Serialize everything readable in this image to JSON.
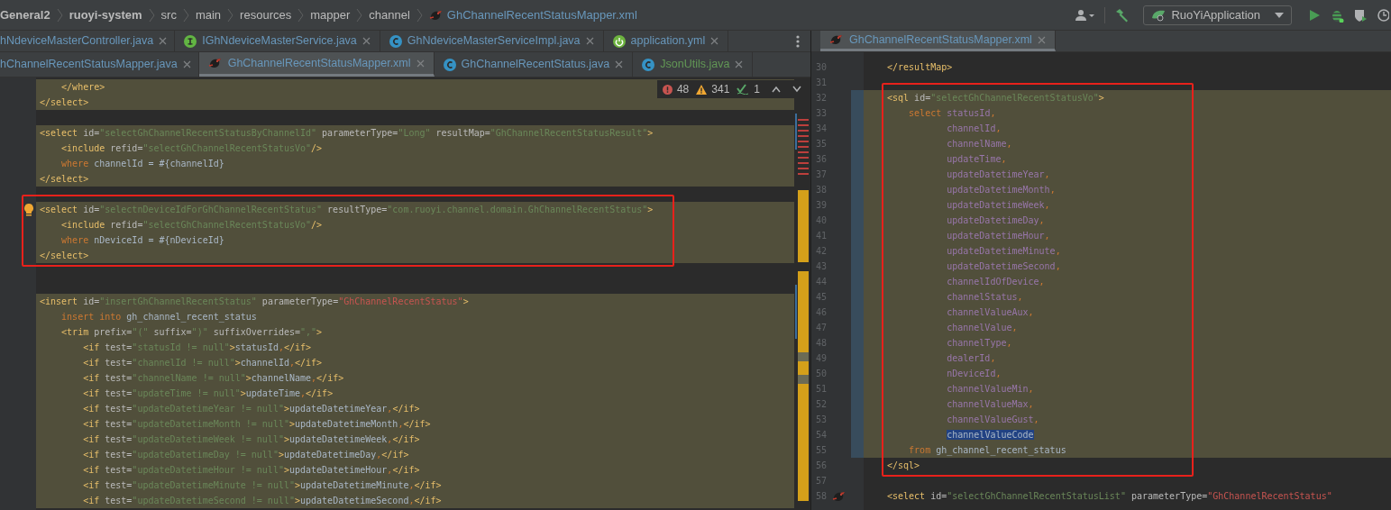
{
  "breadcrumbs": [
    {
      "label": "General2",
      "bold": true,
      "kind": "folder"
    },
    {
      "label": "ruoyi-system",
      "bold": true,
      "kind": "folder"
    },
    {
      "label": "src",
      "bold": false,
      "kind": "folder"
    },
    {
      "label": "main",
      "bold": false,
      "kind": "folder"
    },
    {
      "label": "resources",
      "bold": false,
      "kind": "folder"
    },
    {
      "label": "mapper",
      "bold": false,
      "kind": "folder"
    },
    {
      "label": "channel",
      "bold": false,
      "kind": "folder"
    },
    {
      "label": "GhChannelRecentStatusMapper.xml",
      "bold": false,
      "kind": "xml"
    }
  ],
  "run_config": {
    "label": "RuoYiApplication"
  },
  "left_editor": {
    "tab_rows": [
      [
        {
          "label": "hNdeviceMasterController.java",
          "kind": "none",
          "color": "#6897bb",
          "selected": false
        },
        {
          "label": "IGhNdeviceMasterService.java",
          "kind": "interface",
          "color": "#6897bb",
          "selected": false
        },
        {
          "label": "GhNdeviceMasterServiceImpl.java",
          "kind": "class",
          "color": "#6897bb",
          "selected": false
        },
        {
          "label": "application.yml",
          "kind": "spring",
          "color": "#6897bb",
          "selected": false
        }
      ],
      [
        {
          "label": "hChannelRecentStatusMapper.java",
          "kind": "none",
          "color": "#6897bb",
          "selected": false
        },
        {
          "label": "GhChannelRecentStatusMapper.xml",
          "kind": "xml",
          "color": "#6897bb",
          "selected": true
        },
        {
          "label": "GhChannelRecentStatus.java",
          "kind": "class",
          "color": "#6897bb",
          "selected": false
        },
        {
          "label": "JsonUtils.java",
          "kind": "class",
          "color": "#629755",
          "selected": false
        }
      ]
    ],
    "inspections": {
      "errors": "48",
      "warnings": "341",
      "typos": "1"
    },
    "lines": [
      {
        "highlighted": true,
        "tokens": [
          {
            "kind": "tag",
            "text": "    </where>"
          }
        ]
      },
      {
        "highlighted": true,
        "tokens": [
          {
            "kind": "tag",
            "text": "</select>"
          }
        ]
      },
      {
        "kind": "blank"
      },
      {
        "highlighted": true,
        "tokens": [
          {
            "kind": "tag",
            "text": "<select "
          },
          {
            "kind": "attr",
            "text": "id="
          },
          {
            "kind": "string",
            "text": "\"selectGhChannelRecentStatusByChannelId\""
          },
          {
            "kind": "attr",
            "text": " parameterType="
          },
          {
            "kind": "string",
            "text": "\"Long\""
          },
          {
            "kind": "attr",
            "text": " resultMap="
          },
          {
            "kind": "string",
            "text": "\"GhChannelRecentStatusResult\""
          },
          {
            "kind": "tag",
            "text": ">"
          }
        ]
      },
      {
        "highlighted": true,
        "tokens": [
          {
            "kind": "tag",
            "text": "    <include "
          },
          {
            "kind": "attr",
            "text": "refid="
          },
          {
            "kind": "string",
            "text": "\"selectGhChannelRecentStatusVo\""
          },
          {
            "kind": "tag",
            "text": "/>"
          }
        ]
      },
      {
        "highlighted": true,
        "tokens": [
          {
            "kind": "keyword",
            "text": "    where "
          },
          {
            "kind": "plain",
            "text": "channelId = #{channelId}"
          }
        ]
      },
      {
        "highlighted": true,
        "tokens": [
          {
            "kind": "tag",
            "text": "</select>"
          }
        ]
      },
      {
        "kind": "blank"
      },
      {
        "kind": "frame",
        "lines": [
          {
            "highlighted": true,
            "kind": "intention",
            "tokens": [
              {
                "kind": "tag",
                "text": "<select "
              },
              {
                "kind": "attr",
                "text": "id="
              },
              {
                "kind": "string",
                "text": "\"selectnDeviceIdForGhChannelRecentStatus\""
              },
              {
                "kind": "attr",
                "text": " resultType="
              },
              {
                "kind": "string",
                "text": "\"com.ruoyi.channel.domain.GhChannelRecentStatus\""
              },
              {
                "kind": "tag",
                "text": ">"
              }
            ]
          },
          {
            "highlighted": true,
            "tokens": [
              {
                "kind": "tag",
                "text": "    <include "
              },
              {
                "kind": "attr",
                "text": "refid="
              },
              {
                "kind": "string",
                "text": "\"selectGhChannelRecentStatusVo\""
              },
              {
                "kind": "tag",
                "text": "/>"
              }
            ]
          },
          {
            "highlighted": true,
            "tokens": [
              {
                "kind": "keyword",
                "text": "    where "
              },
              {
                "kind": "plain",
                "text": "nDeviceId = #{nDeviceId}"
              }
            ]
          },
          {
            "highlighted": true,
            "tokens": [
              {
                "kind": "tag",
                "text": "</select>"
              }
            ]
          }
        ]
      },
      {
        "kind": "blank"
      },
      {
        "kind": "blank"
      },
      {
        "highlighted": true,
        "tokens": [
          {
            "kind": "tag",
            "text": "<insert "
          },
          {
            "kind": "attr",
            "text": "id="
          },
          {
            "kind": "string",
            "text": "\"insertGhChannelRecentStatus\""
          },
          {
            "kind": "attr",
            "text": " parameterType="
          },
          {
            "kind": "error",
            "text": "\"GhChannelRecentStatus\""
          },
          {
            "kind": "tag",
            "text": ">"
          }
        ]
      },
      {
        "highlighted": true,
        "tokens": [
          {
            "kind": "keyword",
            "text": "    insert into "
          },
          {
            "kind": "plain",
            "text": "gh_channel_recent_status"
          }
        ]
      },
      {
        "highlighted": true,
        "tokens": [
          {
            "kind": "tag",
            "text": "    <trim "
          },
          {
            "kind": "attr",
            "text": "prefix="
          },
          {
            "kind": "string",
            "text": "\"(\""
          },
          {
            "kind": "attr",
            "text": " suffix="
          },
          {
            "kind": "string",
            "text": "\")\""
          },
          {
            "kind": "attr",
            "text": " suffixOverrides="
          },
          {
            "kind": "string",
            "text": "\",\""
          },
          {
            "kind": "tag",
            "text": ">"
          }
        ]
      },
      {
        "highlighted": true,
        "tokens": [
          {
            "kind": "tag",
            "text": "        <if "
          },
          {
            "kind": "attr",
            "text": "test="
          },
          {
            "kind": "string",
            "text": "\"statusId != null\""
          },
          {
            "kind": "tag",
            "text": ">"
          },
          {
            "kind": "plain",
            "text": "statusId"
          },
          {
            "kind": "comma",
            "text": ","
          },
          {
            "kind": "tag",
            "text": "</if>"
          }
        ]
      },
      {
        "highlighted": true,
        "tokens": [
          {
            "kind": "tag",
            "text": "        <if "
          },
          {
            "kind": "attr",
            "text": "test="
          },
          {
            "kind": "string",
            "text": "\"channelId != null\""
          },
          {
            "kind": "tag",
            "text": ">"
          },
          {
            "kind": "plain",
            "text": "channelId"
          },
          {
            "kind": "comma",
            "text": ","
          },
          {
            "kind": "tag",
            "text": "</if>"
          }
        ]
      },
      {
        "highlighted": true,
        "tokens": [
          {
            "kind": "tag",
            "text": "        <if "
          },
          {
            "kind": "attr",
            "text": "test="
          },
          {
            "kind": "string",
            "text": "\"channelName != null\""
          },
          {
            "kind": "tag",
            "text": ">"
          },
          {
            "kind": "plain",
            "text": "channelName"
          },
          {
            "kind": "comma",
            "text": ","
          },
          {
            "kind": "tag",
            "text": "</if>"
          }
        ]
      },
      {
        "highlighted": true,
        "tokens": [
          {
            "kind": "tag",
            "text": "        <if "
          },
          {
            "kind": "attr",
            "text": "test="
          },
          {
            "kind": "string",
            "text": "\"updateTime != null\""
          },
          {
            "kind": "tag",
            "text": ">"
          },
          {
            "kind": "plain",
            "text": "updateTime"
          },
          {
            "kind": "comma",
            "text": ","
          },
          {
            "kind": "tag",
            "text": "</if>"
          }
        ]
      },
      {
        "highlighted": true,
        "tokens": [
          {
            "kind": "tag",
            "text": "        <if "
          },
          {
            "kind": "attr",
            "text": "test="
          },
          {
            "kind": "string",
            "text": "\"updateDatetimeYear != null\""
          },
          {
            "kind": "tag",
            "text": ">"
          },
          {
            "kind": "plain",
            "text": "updateDatetimeYear"
          },
          {
            "kind": "comma",
            "text": ","
          },
          {
            "kind": "tag",
            "text": "</if>"
          }
        ]
      },
      {
        "highlighted": true,
        "tokens": [
          {
            "kind": "tag",
            "text": "        <if "
          },
          {
            "kind": "attr",
            "text": "test="
          },
          {
            "kind": "string",
            "text": "\"updateDatetimeMonth != null\""
          },
          {
            "kind": "tag",
            "text": ">"
          },
          {
            "kind": "plain",
            "text": "updateDatetimeMonth"
          },
          {
            "kind": "comma",
            "text": ","
          },
          {
            "kind": "tag",
            "text": "</if>"
          }
        ]
      },
      {
        "highlighted": true,
        "tokens": [
          {
            "kind": "tag",
            "text": "        <if "
          },
          {
            "kind": "attr",
            "text": "test="
          },
          {
            "kind": "string",
            "text": "\"updateDatetimeWeek != null\""
          },
          {
            "kind": "tag",
            "text": ">"
          },
          {
            "kind": "plain",
            "text": "updateDatetimeWeek"
          },
          {
            "kind": "comma",
            "text": ","
          },
          {
            "kind": "tag",
            "text": "</if>"
          }
        ]
      },
      {
        "highlighted": true,
        "tokens": [
          {
            "kind": "tag",
            "text": "        <if "
          },
          {
            "kind": "attr",
            "text": "test="
          },
          {
            "kind": "string",
            "text": "\"updateDatetimeDay != null\""
          },
          {
            "kind": "tag",
            "text": ">"
          },
          {
            "kind": "plain",
            "text": "updateDatetimeDay"
          },
          {
            "kind": "comma",
            "text": ","
          },
          {
            "kind": "tag",
            "text": "</if>"
          }
        ]
      },
      {
        "highlighted": true,
        "tokens": [
          {
            "kind": "tag",
            "text": "        <if "
          },
          {
            "kind": "attr",
            "text": "test="
          },
          {
            "kind": "string",
            "text": "\"updateDatetimeHour != null\""
          },
          {
            "kind": "tag",
            "text": ">"
          },
          {
            "kind": "plain",
            "text": "updateDatetimeHour"
          },
          {
            "kind": "comma",
            "text": ","
          },
          {
            "kind": "tag",
            "text": "</if>"
          }
        ]
      },
      {
        "highlighted": true,
        "tokens": [
          {
            "kind": "tag",
            "text": "        <if "
          },
          {
            "kind": "attr",
            "text": "test="
          },
          {
            "kind": "string",
            "text": "\"updateDatetimeMinute != null\""
          },
          {
            "kind": "tag",
            "text": ">"
          },
          {
            "kind": "plain",
            "text": "updateDatetimeMinute"
          },
          {
            "kind": "comma",
            "text": ","
          },
          {
            "kind": "tag",
            "text": "</if>"
          }
        ]
      },
      {
        "highlighted": true,
        "tokens": [
          {
            "kind": "tag",
            "text": "        <if "
          },
          {
            "kind": "attr",
            "text": "test="
          },
          {
            "kind": "string",
            "text": "\"updateDatetimeSecond != null\""
          },
          {
            "kind": "tag",
            "text": ">"
          },
          {
            "kind": "plain",
            "text": "updateDatetimeSecond"
          },
          {
            "kind": "comma",
            "text": ","
          },
          {
            "kind": "tag",
            "text": "</if>"
          }
        ]
      }
    ]
  },
  "right_editor": {
    "tabs": [
      {
        "label": "GhChannelRecentStatusMapper.xml",
        "kind": "xml",
        "color": "#6897bb",
        "selected": true
      }
    ],
    "lines": [
      {
        "number": "30",
        "highlighted": false,
        "tokens": [
          {
            "kind": "tag",
            "text": "</resultMap>"
          }
        ]
      },
      {
        "number": "31",
        "kind": "blank"
      },
      {
        "kind": "frame",
        "lines": [
          {
            "number": "32",
            "highlighted": true,
            "tokens": [
              {
                "kind": "tag",
                "text": "<sql "
              },
              {
                "kind": "attr",
                "text": "id="
              },
              {
                "kind": "string",
                "text": "\"selectGhChannelRecentStatusVo\""
              },
              {
                "kind": "tag",
                "text": ">"
              }
            ]
          },
          {
            "number": "33",
            "highlighted": true,
            "tokens": [
              {
                "kind": "keyword",
                "text": "    select "
              },
              {
                "kind": "column",
                "text": "statusId"
              },
              {
                "kind": "comma",
                "text": ","
              }
            ]
          },
          {
            "number": "34",
            "highlighted": true,
            "tokens": [
              {
                "kind": "column",
                "text": "           channelId"
              },
              {
                "kind": "comma",
                "text": ","
              }
            ]
          },
          {
            "number": "35",
            "highlighted": true,
            "tokens": [
              {
                "kind": "column",
                "text": "           channelName"
              },
              {
                "kind": "comma",
                "text": ","
              }
            ]
          },
          {
            "number": "36",
            "highlighted": true,
            "tokens": [
              {
                "kind": "column",
                "text": "           updateTime"
              },
              {
                "kind": "comma",
                "text": ","
              }
            ]
          },
          {
            "number": "37",
            "highlighted": true,
            "tokens": [
              {
                "kind": "column",
                "text": "           updateDatetimeYear"
              },
              {
                "kind": "comma",
                "text": ","
              }
            ]
          },
          {
            "number": "38",
            "highlighted": true,
            "tokens": [
              {
                "kind": "column",
                "text": "           updateDatetimeMonth"
              },
              {
                "kind": "comma",
                "text": ","
              }
            ]
          },
          {
            "number": "39",
            "highlighted": true,
            "tokens": [
              {
                "kind": "column",
                "text": "           updateDatetimeWeek"
              },
              {
                "kind": "comma",
                "text": ","
              }
            ]
          },
          {
            "number": "40",
            "highlighted": true,
            "tokens": [
              {
                "kind": "column",
                "text": "           updateDatetimeDay"
              },
              {
                "kind": "comma",
                "text": ","
              }
            ]
          },
          {
            "number": "41",
            "highlighted": true,
            "tokens": [
              {
                "kind": "column",
                "text": "           updateDatetimeHour"
              },
              {
                "kind": "comma",
                "text": ","
              }
            ]
          },
          {
            "number": "42",
            "highlighted": true,
            "tokens": [
              {
                "kind": "column",
                "text": "           updateDatetimeMinute"
              },
              {
                "kind": "comma",
                "text": ","
              }
            ]
          },
          {
            "number": "43",
            "highlighted": true,
            "tokens": [
              {
                "kind": "column",
                "text": "           updateDatetimeSecond"
              },
              {
                "kind": "comma",
                "text": ","
              }
            ]
          },
          {
            "number": "44",
            "highlighted": true,
            "tokens": [
              {
                "kind": "column",
                "text": "           channelIdOfDevice"
              },
              {
                "kind": "comma",
                "text": ","
              }
            ]
          },
          {
            "number": "45",
            "highlighted": true,
            "tokens": [
              {
                "kind": "column",
                "text": "           channelStatus"
              },
              {
                "kind": "comma",
                "text": ","
              }
            ]
          },
          {
            "number": "46",
            "highlighted": true,
            "tokens": [
              {
                "kind": "column",
                "text": "           channelValueAux"
              },
              {
                "kind": "comma",
                "text": ","
              }
            ]
          },
          {
            "number": "47",
            "highlighted": true,
            "tokens": [
              {
                "kind": "column",
                "text": "           channelValue"
              },
              {
                "kind": "comma",
                "text": ","
              }
            ]
          },
          {
            "number": "48",
            "highlighted": true,
            "tokens": [
              {
                "kind": "column",
                "text": "           channelType"
              },
              {
                "kind": "comma",
                "text": ","
              }
            ]
          },
          {
            "number": "49",
            "highlighted": true,
            "tokens": [
              {
                "kind": "column",
                "text": "           dealerId"
              },
              {
                "kind": "comma",
                "text": ","
              }
            ]
          },
          {
            "number": "50",
            "highlighted": true,
            "tokens": [
              {
                "kind": "column",
                "text": "           nDeviceId"
              },
              {
                "kind": "comma",
                "text": ","
              }
            ]
          },
          {
            "number": "51",
            "highlighted": true,
            "tokens": [
              {
                "kind": "column",
                "text": "           channelValueMin"
              },
              {
                "kind": "comma",
                "text": ","
              }
            ]
          },
          {
            "number": "52",
            "highlighted": true,
            "tokens": [
              {
                "kind": "column",
                "text": "           channelValueMax"
              },
              {
                "kind": "comma",
                "text": ","
              }
            ]
          },
          {
            "number": "53",
            "highlighted": true,
            "tokens": [
              {
                "kind": "column",
                "text": "           channelValueGust"
              },
              {
                "kind": "comma",
                "text": ","
              }
            ]
          },
          {
            "number": "54",
            "highlighted": true,
            "tokens": [
              {
                "kind": "selection",
                "text": "           channelValueCode"
              }
            ]
          },
          {
            "number": "55",
            "highlighted": true,
            "tokens": [
              {
                "kind": "keyword",
                "text": "    from "
              },
              {
                "kind": "plain",
                "text": "gh_channel_recent_status"
              }
            ]
          },
          {
            "number": "56",
            "highlighted": false,
            "tokens": [
              {
                "kind": "tag",
                "text": "</sql>"
              }
            ]
          }
        ]
      },
      {
        "number": "57",
        "kind": "blank"
      },
      {
        "number": "58",
        "highlighted": false,
        "kind": "mapper",
        "tokens": [
          {
            "kind": "tag",
            "text": "<select "
          },
          {
            "kind": "attr",
            "text": "id="
          },
          {
            "kind": "string",
            "text": "\"selectGhChannelRecentStatusList\""
          },
          {
            "kind": "attr",
            "text": " parameterType="
          },
          {
            "kind": "error",
            "text": "\"GhChannelRecentStatus\""
          }
        ]
      }
    ]
  }
}
